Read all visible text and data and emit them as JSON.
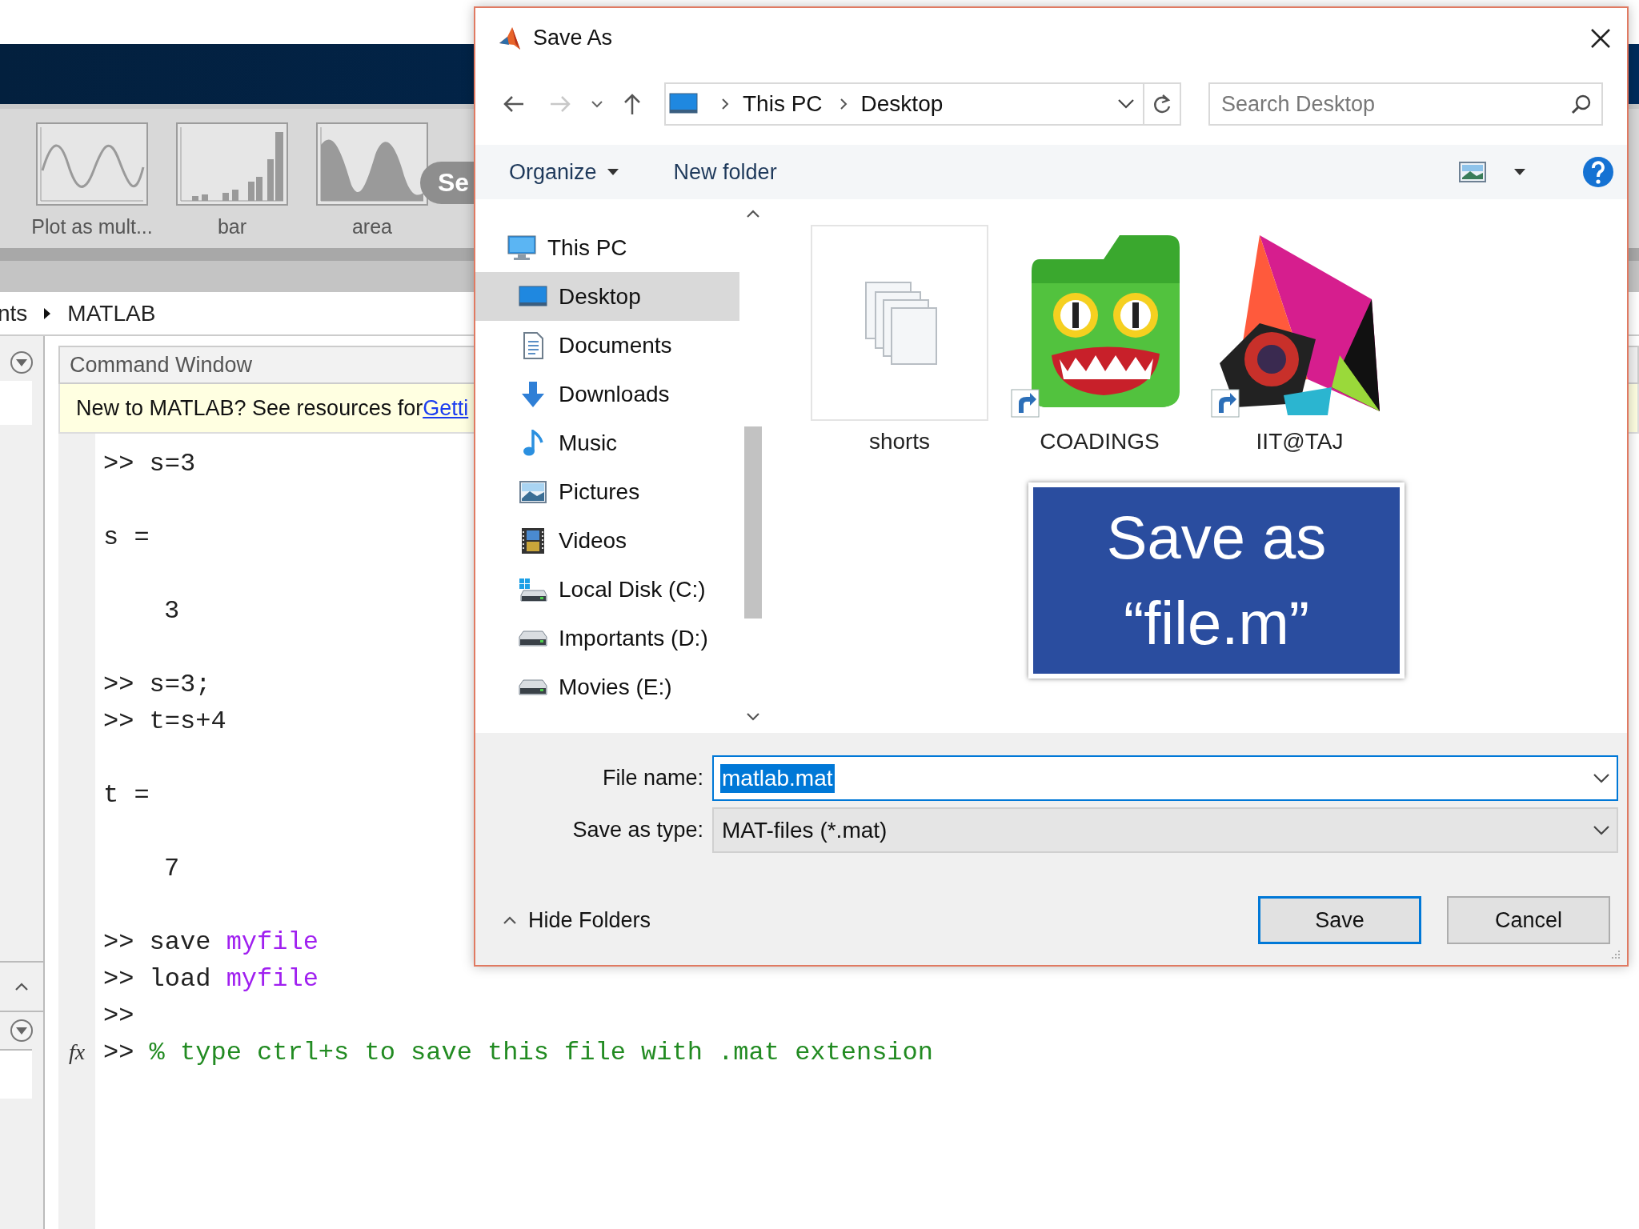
{
  "matlab": {
    "gallery": [
      {
        "label": "Plot as mult...",
        "kind": "line"
      },
      {
        "label": "bar",
        "kind": "bar"
      },
      {
        "label": "area",
        "kind": "area"
      }
    ],
    "gallery_more": "Se",
    "breadcrumb": [
      "nts",
      "MATLAB"
    ],
    "command_window": {
      "title": "Command Window",
      "banner": {
        "text": "New to MATLAB? See resources for ",
        "link": "Getti"
      },
      "lines": [
        {
          "kind": "command",
          "code": "s=3"
        },
        {
          "kind": "blank"
        },
        {
          "kind": "output",
          "text": "s ="
        },
        {
          "kind": "blank"
        },
        {
          "kind": "value",
          "text": "3"
        },
        {
          "kind": "blank"
        },
        {
          "kind": "command",
          "code": "s=3;"
        },
        {
          "kind": "command",
          "code": "t=s+4"
        },
        {
          "kind": "blank"
        },
        {
          "kind": "output",
          "text": "t ="
        },
        {
          "kind": "blank"
        },
        {
          "kind": "value",
          "text": "7"
        },
        {
          "kind": "blank"
        },
        {
          "kind": "command",
          "code": "save ",
          "arg": "myfile"
        },
        {
          "kind": "command",
          "code": "load ",
          "arg": "myfile"
        },
        {
          "kind": "prompt"
        },
        {
          "kind": "comment",
          "gutter": "fx",
          "code": "% type ctrl+s to save this file with .mat extension"
        }
      ],
      "prompt": ">>"
    }
  },
  "dialog": {
    "title": "Save As",
    "address": [
      "This PC",
      "Desktop"
    ],
    "search": {
      "placeholder": "Search Desktop"
    },
    "toolbar": [
      {
        "label": "Organize",
        "menu": true
      },
      {
        "label": "New folder",
        "menu": false
      }
    ],
    "nav": [
      {
        "label": "This PC",
        "kind": "monitor",
        "selected": false,
        "children": [
          {
            "label": "Desktop",
            "kind": "desktop",
            "selected": true
          },
          {
            "label": "Documents",
            "kind": "document",
            "selected": false
          },
          {
            "label": "Downloads",
            "kind": "download",
            "selected": false
          },
          {
            "label": "Music",
            "kind": "music",
            "selected": false
          },
          {
            "label": "Pictures",
            "kind": "pictures",
            "selected": false
          },
          {
            "label": "Videos",
            "kind": "videos",
            "selected": false
          },
          {
            "label": "Local Disk (C:)",
            "kind": "system-drive",
            "selected": false
          },
          {
            "label": "Importants (D:)",
            "kind": "drive",
            "selected": false
          },
          {
            "label": "Movies (E:)",
            "kind": "drive",
            "selected": false
          }
        ]
      }
    ],
    "files": [
      {
        "name": "shorts",
        "kind": "pages",
        "shortcut": false
      },
      {
        "name": "COADINGS",
        "kind": "green-folder",
        "shortcut": true
      },
      {
        "name": "IIT@TAJ",
        "kind": "prism",
        "shortcut": true
      }
    ],
    "file_name": {
      "label": "File name:",
      "value": "matlab.mat",
      "text_selected": true
    },
    "save_type": {
      "label": "Save as type:",
      "value": "MAT-files (*.mat)"
    },
    "hide_folders": "Hide Folders",
    "buttons": [
      {
        "label": "Save",
        "default": true
      },
      {
        "label": "Cancel",
        "default": false
      }
    ]
  },
  "callout": {
    "lines": [
      "Save as",
      "“file.m”"
    ]
  }
}
